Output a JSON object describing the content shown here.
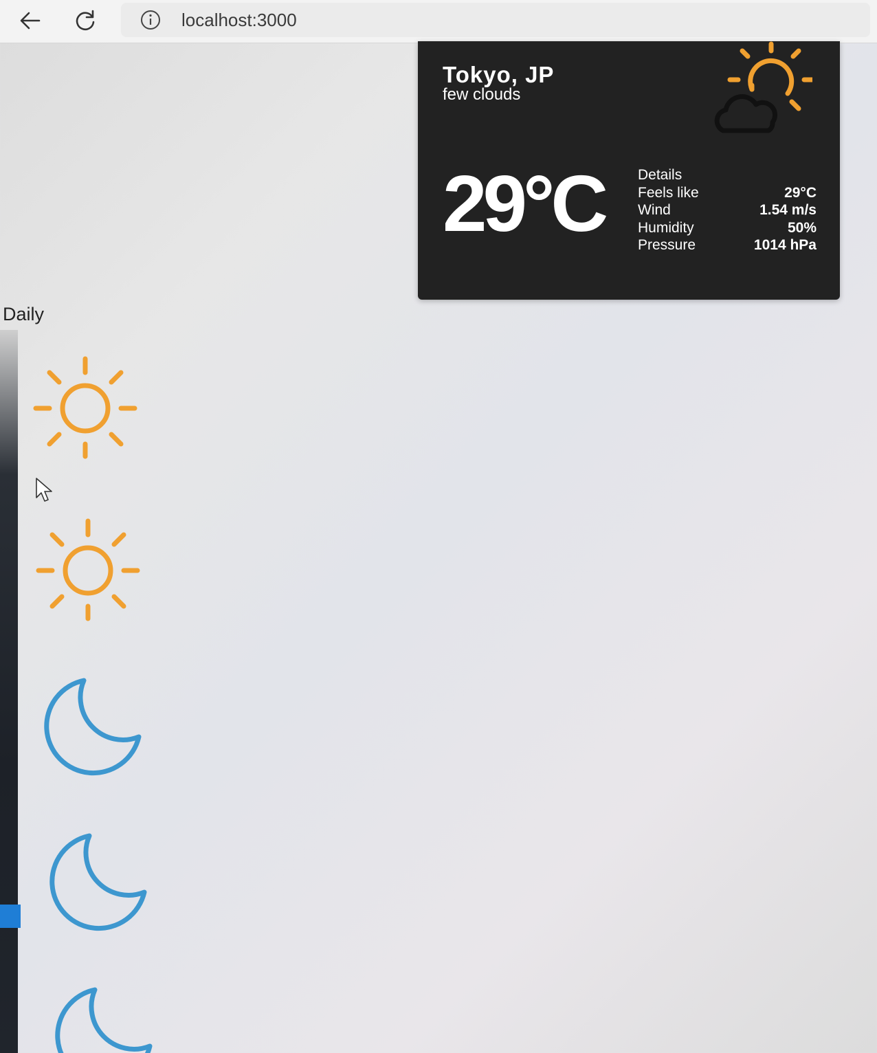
{
  "browser": {
    "url": "localhost:3000",
    "back_icon": "arrow-left-icon",
    "reload_icon": "reload-icon",
    "info_icon": "info-icon"
  },
  "weather": {
    "city": "Tokyo, JP",
    "description": "few clouds",
    "temperature": "29°C",
    "icon": "sun-cloud-icon",
    "details_heading": "Details",
    "details": [
      {
        "label": "Feels like",
        "value": "29°C"
      },
      {
        "label": "Wind",
        "value": "1.54 m/s"
      },
      {
        "label": "Humidity",
        "value": "50%"
      },
      {
        "label": "Pressure",
        "value": "1014 hPa"
      }
    ]
  },
  "daily": {
    "title": "Daily",
    "icons": [
      "sun-icon",
      "sun-icon",
      "moon-icon",
      "moon-icon",
      "moon-icon"
    ]
  },
  "colors": {
    "sun": "#f0a030",
    "moon": "#3d97cf",
    "card_bg": "#222222"
  }
}
